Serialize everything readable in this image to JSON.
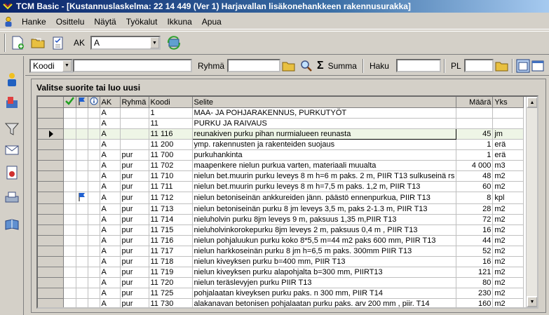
{
  "window": {
    "title": "TCM Basic - [Kustannuslaskelma: 22 14 449 (Ver 1) Harjavallan lisäkonehankkeen rakennusurakka]"
  },
  "menu": [
    "Hanke",
    "Osittelu",
    "Näytä",
    "Työkalut",
    "Ikkuna",
    "Apua"
  ],
  "toolbar": {
    "ak_label": "AK",
    "ak_value": "A"
  },
  "filter": {
    "field_combo": "Koodi",
    "ryhma_label": "Ryhmä",
    "summa_label": "Summa",
    "haku_label": "Haku",
    "pl_label": "PL"
  },
  "panel": {
    "title": "Valitse suorite tai luo uusi"
  },
  "table": {
    "headers": [
      "AK",
      "Ryhmä",
      "Koodi",
      "Selite",
      "Määrä",
      "Yks"
    ],
    "rows": [
      {
        "ak": "A",
        "ryhma": "",
        "koodi": "1",
        "selite": "MAA- JA POHJARAKENNUS, PURKUTYÖT",
        "maara": "",
        "yks": ""
      },
      {
        "ak": "A",
        "ryhma": "",
        "koodi": "11",
        "selite": "PURKU JA RAIVAUS",
        "maara": "",
        "yks": ""
      },
      {
        "ak": "A",
        "ryhma": "",
        "koodi": "11  116",
        "selite": "reunakiven purku pihan nurmialueen reunasta",
        "maara": "45",
        "yks": "jm"
      },
      {
        "ak": "A",
        "ryhma": "",
        "koodi": "11  200",
        "selite": "ymp. rakennusten ja rakenteiden suojaus",
        "maara": "1",
        "yks": "erä"
      },
      {
        "ak": "A",
        "ryhma": "pur",
        "koodi": "11  700",
        "selite": "purkuhankinta",
        "maara": "1",
        "yks": "erä"
      },
      {
        "ak": "A",
        "ryhma": "pur",
        "koodi": "11  702",
        "selite": "maapenkere nielun purkua varten, materiaali muualta",
        "maara": "4 000",
        "yks": "m3"
      },
      {
        "ak": "A",
        "ryhma": "pur",
        "koodi": "11  710",
        "selite": "nielun bet.muurin purku leveys 8 m h=6 m paks. 2 m, PIIR T13 sulkuseinä rs",
        "maara": "48",
        "yks": "m2"
      },
      {
        "ak": "A",
        "ryhma": "pur",
        "koodi": "11  711",
        "selite": "nielun bet.muurin purku leveys 8 m h=7,5 m paks. 1,2 m,  PIIR T13",
        "maara": "60",
        "yks": "m2"
      },
      {
        "ak": "A",
        "ryhma": "pur",
        "koodi": "11  712",
        "selite": "nielun betoniseinän ankkureiden jänn. päästö ennenpurkua, PIIR T13",
        "maara": "8",
        "yks": "kpl"
      },
      {
        "ak": "A",
        "ryhma": "pur",
        "koodi": "11  713",
        "selite": "nielun betoniseinän  purku  8 jm leveys 3,5 m, paks 2-1.3 m, PIIR T13",
        "maara": "28",
        "yks": "m2"
      },
      {
        "ak": "A",
        "ryhma": "pur",
        "koodi": "11  714",
        "selite": "nieluholvin purku 8jm leveys 9 m, paksuus 1,35 m,PIIR T13",
        "maara": "72",
        "yks": "m2"
      },
      {
        "ak": "A",
        "ryhma": "pur",
        "koodi": "11  715",
        "selite": "nieluholvinkorokepurku  8jm leveys 2 m, paksuus 0,4 m , PIIR T13",
        "maara": "16",
        "yks": "m2"
      },
      {
        "ak": "A",
        "ryhma": "pur",
        "koodi": "11  716",
        "selite": "nielun pohjaluukun purku koko 8*5,5 m=44 m2 paks 600 mm, PIIR T13",
        "maara": "44",
        "yks": "m2"
      },
      {
        "ak": "A",
        "ryhma": "pur",
        "koodi": "11  717",
        "selite": "nielun harkkoseinän purku  8 jm h=6,5 m paks. 300mm PIIR T13",
        "maara": "52",
        "yks": "m2"
      },
      {
        "ak": "A",
        "ryhma": "pur",
        "koodi": "11  718",
        "selite": "nielun kiveyksen purku b=400 mm, PIIR T13",
        "maara": "16",
        "yks": "m2"
      },
      {
        "ak": "A",
        "ryhma": "pur",
        "koodi": "11  719",
        "selite": "nielun kiveyksen purku alapohjalta  b=300 mm, PIIRT13",
        "maara": "121",
        "yks": "m2"
      },
      {
        "ak": "A",
        "ryhma": "pur",
        "koodi": "11  720",
        "selite": "nielun teräslevyjen purku  PIIR T13",
        "maara": "80",
        "yks": "m2"
      },
      {
        "ak": "A",
        "ryhma": "pur",
        "koodi": "11  725",
        "selite": "pohjalaatan kiveyksen purku paks. n 300 mm, PIIR T14",
        "maara": "230",
        "yks": "m2"
      },
      {
        "ak": "A",
        "ryhma": "pur",
        "koodi": "11  730",
        "selite": "alakanavan betonisen pohjalaatan purku paks. arv 200 mm ,  piir. T14",
        "maara": "160",
        "yks": "m2"
      }
    ]
  },
  "colors": {
    "title_start": "#0a246a",
    "title_end": "#a6caf0",
    "selected_row": "#eef5e6"
  }
}
